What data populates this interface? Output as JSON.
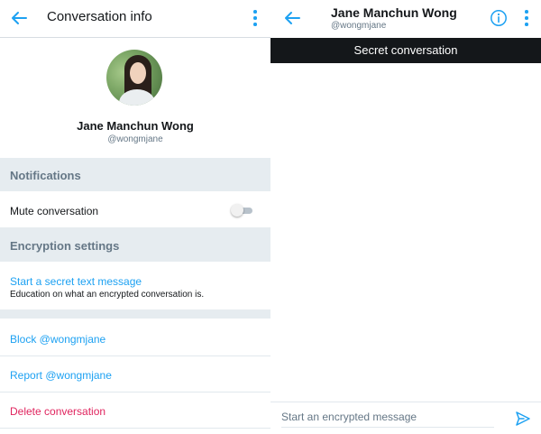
{
  "info_panel": {
    "title": "Conversation info",
    "profile": {
      "name": "Jane Manchun Wong",
      "handle": "@wongmjane"
    },
    "notifications": {
      "header": "Notifications",
      "mute_label": "Mute conversation",
      "mute_enabled": false
    },
    "encryption": {
      "header": "Encryption settings",
      "secret_label": "Start a secret text message",
      "secret_sub": "Education on what an encrypted conversation is."
    },
    "actions": {
      "block": "Block @wongmjane",
      "report": "Report @wongmjane",
      "delete": "Delete conversation"
    }
  },
  "chat_panel": {
    "name": "Jane Manchun Wong",
    "handle": "@wongmjane",
    "banner": "Secret conversation",
    "compose_placeholder": "Start an encrypted message"
  },
  "icons": {
    "back": "arrow-left-icon",
    "menu": "kebab-menu-icon",
    "info": "info-circle-icon",
    "send": "send-icon"
  },
  "colors": {
    "accent": "#1da1f2",
    "danger": "#e0245e",
    "section_bg": "#e6ecf0",
    "banner_bg": "#14171a"
  }
}
